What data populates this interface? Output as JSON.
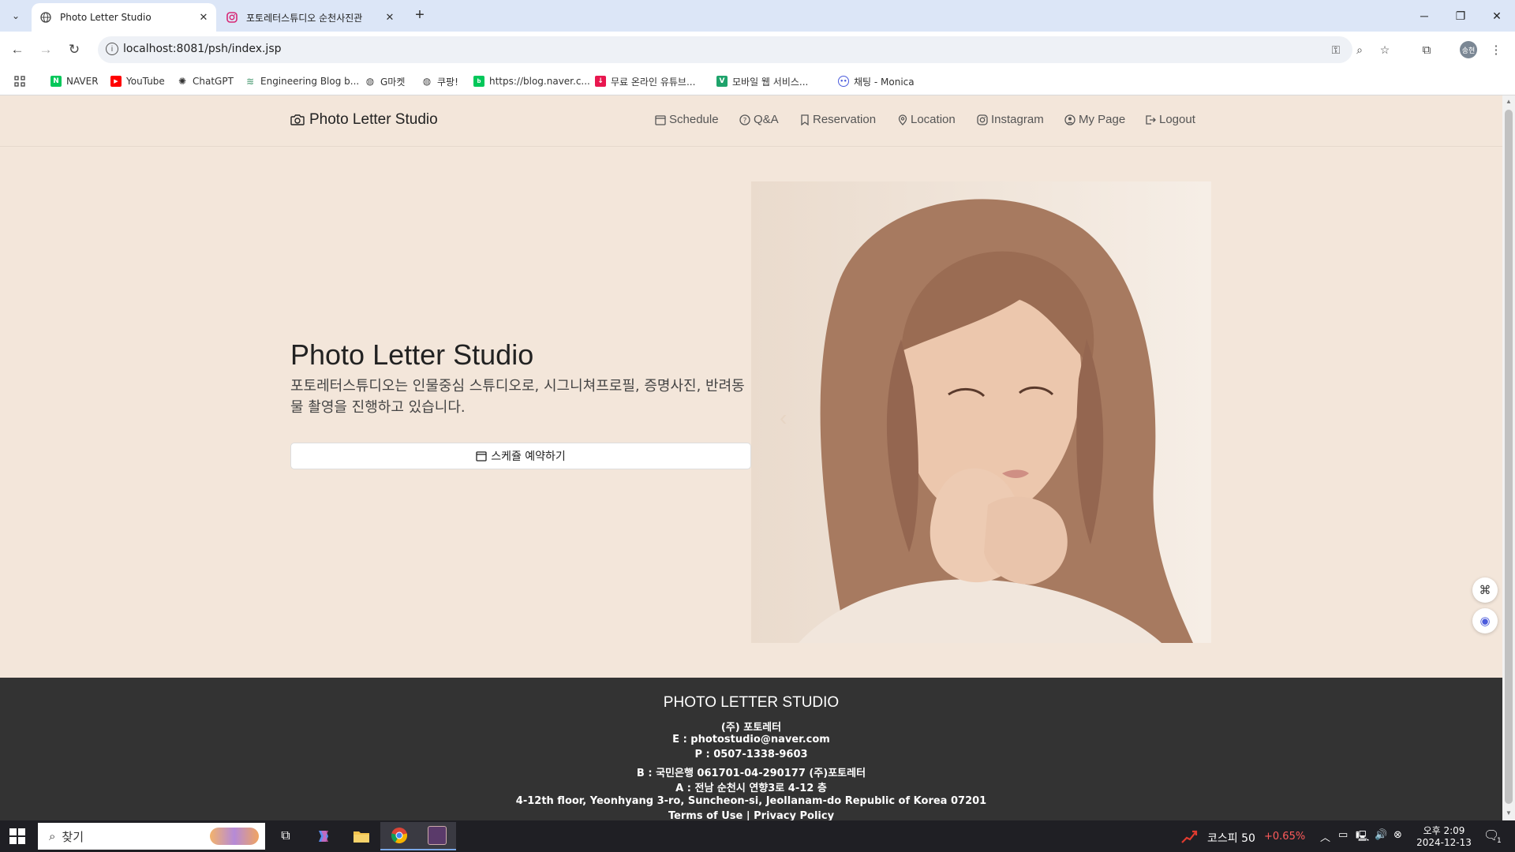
{
  "browser": {
    "tabs": [
      {
        "title": "Photo Letter Studio",
        "active": true
      },
      {
        "title": "포토레터스튜디오 순천사진관",
        "active": false
      }
    ],
    "url": "localhost:8081/psh/index.jsp",
    "profile_initials": "송현",
    "bookmarks": [
      "NAVER",
      "YouTube",
      "ChatGPT",
      "Engineering Blog b...",
      "G마켓",
      "쿠팡!",
      "https://blog.naver.c...",
      "무료 온라인 유튜브...",
      "모바일 웹 서비스...",
      "채팅 - Monica"
    ]
  },
  "site": {
    "brand": "Photo Letter Studio",
    "nav": [
      "Schedule",
      "Q&A",
      "Reservation",
      "Location",
      "Instagram",
      "My Page",
      "Logout"
    ],
    "hero": {
      "title": "Photo Letter Studio",
      "description": "포토레터스튜디오는 인물중심 스튜디오로, 시그니쳐프로필, 증명사진, 반려동물 촬영을 진행하고 있습니다.",
      "button": "스케쥴 예약하기"
    },
    "footer": {
      "title": "PHOTO LETTER STUDIO",
      "company": "(주) 포토레터",
      "email": "E : photostudio@naver.com",
      "phone": "P : 0507-1338-9603",
      "bank": "B : 국민은행 061701-04-290177 (주)포토레터",
      "address_kr": "A : 전남 순천시 연향3로 4-12 층",
      "address_en": "4-12th floor, Yeonhyang 3-ro, Suncheon-si, Jeollanam-do Republic of Korea 07201",
      "links": "Terms of Use | Privacy Policy"
    }
  },
  "taskbar": {
    "search_placeholder": "찾기",
    "stock_name": "코스피 50",
    "stock_change": "+0.65%",
    "time": "오후 2:09",
    "date": "2024-12-13",
    "notification_count": "1"
  },
  "colors": {
    "page_bg": "#f3e6da",
    "footer_bg": "#333333",
    "tab_strip": "#dce6f7",
    "stock_change": "#ff5b5b"
  }
}
